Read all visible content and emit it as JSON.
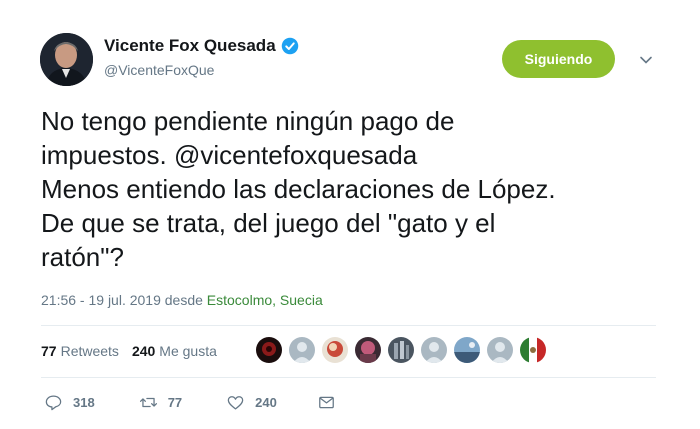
{
  "user": {
    "display_name": "Vicente Fox Quesada",
    "handle": "@VicenteFoxQue",
    "verified_icon": "verified-badge-icon"
  },
  "follow_button": {
    "label": "Siguiendo",
    "color": "#8fc02f"
  },
  "tweet": {
    "text": "No tengo pendiente ningún pago de\nimpuestos. @vicentefoxquesada\nMenos entiendo las declaraciones de López.\nDe que se trata, del juego del \"gato y el\nratón\"?"
  },
  "meta": {
    "timestamp": "21:56 - 19 jul. 2019 desde",
    "location": "Estocolmo, Suecia"
  },
  "stats": {
    "retweets_count": "77",
    "retweets_label": "Retweets",
    "likes_count": "240",
    "likes_label": "Me gusta"
  },
  "actions": {
    "reply_count": "318",
    "retweet_count": "77",
    "like_count": "240"
  },
  "colors": {
    "link_location": "#3a8a3a",
    "muted": "#657786",
    "verified": "#1da1f2"
  }
}
